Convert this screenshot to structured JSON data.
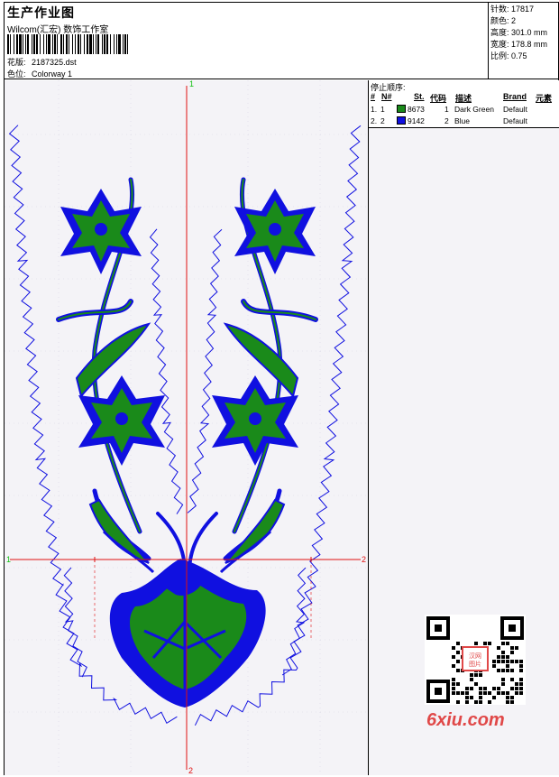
{
  "header": {
    "title": "生产作业图",
    "subtitle": "Wilcom(汇宏) 数饰工作室",
    "design_label": "花版:",
    "design_file": "2187325.dst",
    "colorway_label": "色位:",
    "colorway": "Colorway 1"
  },
  "stats": [
    {
      "label": "针数:",
      "value": "17817"
    },
    {
      "label": "颜色:",
      "value": "2"
    },
    {
      "label": "高度:",
      "value": "301.0 mm"
    },
    {
      "label": "宽度:",
      "value": "178.8 mm"
    },
    {
      "label": "比例:",
      "value": "0.75"
    }
  ],
  "stop_sequence": {
    "title": "停止顺序:",
    "headers": {
      "num": "#",
      "n": "N#",
      "st": "St.",
      "code": "代码",
      "desc": "描述",
      "brand": "Brand",
      "elem": "元素"
    },
    "rows": [
      {
        "num": "1.",
        "n": "1",
        "color": "#1a8a1a",
        "st": "8673",
        "code": "1",
        "desc": "Dark Green",
        "brand": "Default"
      },
      {
        "num": "2.",
        "n": "2",
        "color": "#1010e0",
        "st": "9142",
        "code": "2",
        "desc": "Blue",
        "brand": "Default"
      }
    ]
  },
  "canvas": {
    "axis_labels": [
      "1",
      "2",
      "1",
      "2"
    ],
    "thread_colors": {
      "green": "#1a8a1a",
      "blue": "#1010e0",
      "axis": "#e01010",
      "marker": "#10c010"
    }
  },
  "watermark": {
    "site": "6xiu.com",
    "qr_label": "汉网图片"
  }
}
